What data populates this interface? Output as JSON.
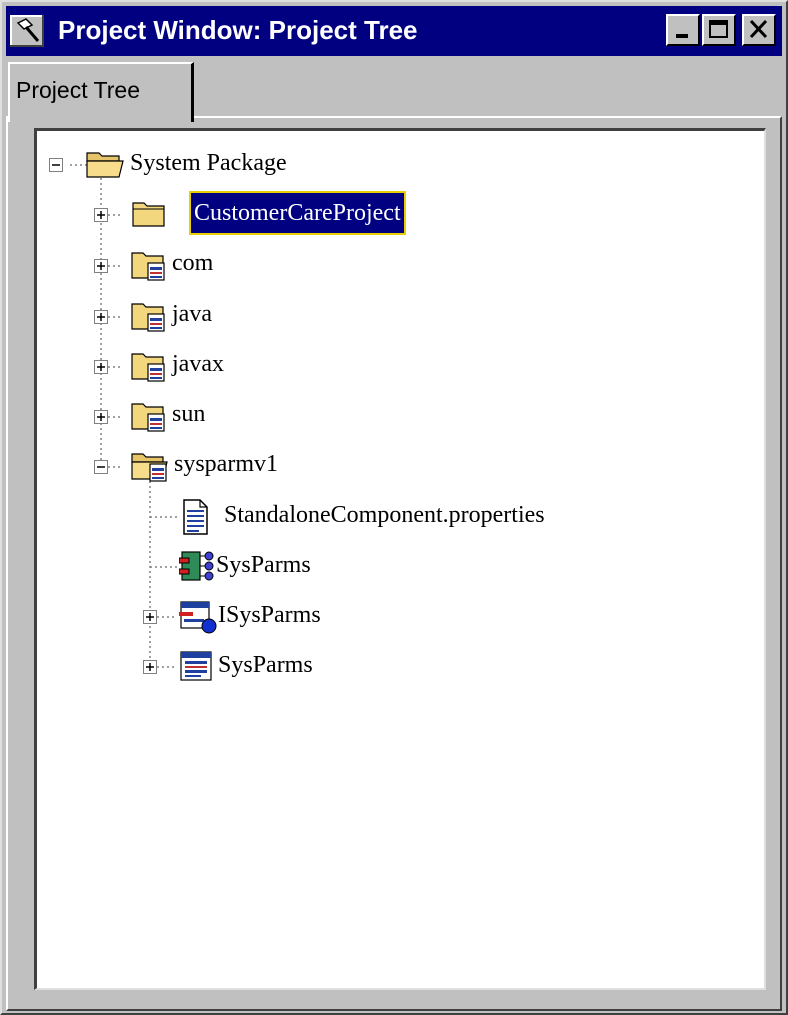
{
  "window": {
    "title": "Project Window: Project Tree",
    "icon": "hammer-icon",
    "controls": [
      "minimize-icon",
      "maximize-icon",
      "close-icon"
    ]
  },
  "tabs": [
    {
      "label": "Project Tree",
      "active": true
    }
  ],
  "tree": {
    "root": {
      "label": "System Package",
      "icon": "folder-open-icon",
      "expanded": true
    },
    "items": [
      {
        "label": "CustomerCareProject",
        "icon": "folder-icon",
        "expander": "plus",
        "selected": true
      },
      {
        "label": "com",
        "icon": "package-folder-icon",
        "expander": "plus"
      },
      {
        "label": "java",
        "icon": "package-folder-icon",
        "expander": "plus"
      },
      {
        "label": "javax",
        "icon": "package-folder-icon",
        "expander": "plus"
      },
      {
        "label": "sun",
        "icon": "package-folder-icon",
        "expander": "plus"
      },
      {
        "label": "sysparmv1",
        "icon": "package-folder-open-icon",
        "expander": "minus",
        "children": [
          {
            "label": "StandaloneComponent.properties",
            "icon": "properties-file-icon",
            "expander": "none"
          },
          {
            "label": "SysParms",
            "icon": "component-icon",
            "expander": "none"
          },
          {
            "label": "ISysParms",
            "icon": "interface-icon",
            "expander": "plus"
          },
          {
            "label": "SysParms",
            "icon": "class-icon",
            "expander": "plus"
          }
        ]
      }
    ]
  },
  "colors": {
    "titlebar": "#000080",
    "face": "#c0c0c0",
    "selection": "#000080",
    "selection_outline": "#e8d000"
  }
}
